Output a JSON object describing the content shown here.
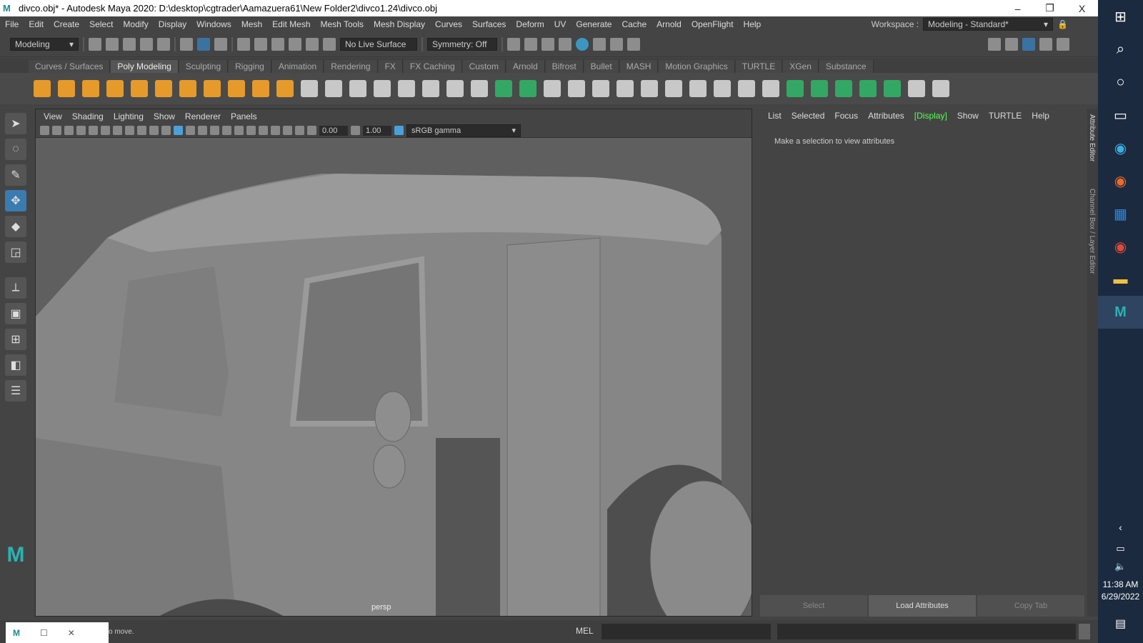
{
  "title": "divco.obj* - Autodesk Maya 2020: D:\\desktop\\cgtrader\\Aamazuera61\\New Folder2\\divco1.24\\divco.obj",
  "window_controls": {
    "minimize": "–",
    "restore": "❐",
    "close": "X"
  },
  "menus": [
    "File",
    "Edit",
    "Create",
    "Select",
    "Modify",
    "Display",
    "Windows",
    "Mesh",
    "Edit Mesh",
    "Mesh Tools",
    "Mesh Display",
    "Curves",
    "Surfaces",
    "Deform",
    "UV",
    "Generate",
    "Cache",
    "Arnold",
    "OpenFlight",
    "Help"
  ],
  "workspace": {
    "label": "Workspace :",
    "value": "Modeling - Standard*"
  },
  "statusline": {
    "mode": "Modeling",
    "live_surface": "No Live Surface",
    "symmetry": "Symmetry: Off"
  },
  "shelf_tabs": [
    "Curves / Surfaces",
    "Poly Modeling",
    "Sculpting",
    "Rigging",
    "Animation",
    "Rendering",
    "FX",
    "FX Caching",
    "Custom",
    "Arnold",
    "Bifrost",
    "Bullet",
    "MASH",
    "Motion Graphics",
    "TURTLE",
    "XGen",
    "Substance"
  ],
  "active_shelf_tab": "Poly Modeling",
  "viewport": {
    "menus": [
      "View",
      "Shading",
      "Lighting",
      "Show",
      "Renderer",
      "Panels"
    ],
    "exposure": "0.00",
    "gamma": "1.00",
    "color_space": "sRGB gamma",
    "camera": "persp"
  },
  "attribute_editor": {
    "menus": [
      "List",
      "Selected",
      "Focus",
      "Attributes",
      "[Display]",
      "Show",
      "TURTLE",
      "Help"
    ],
    "message": "Make a selection to view attributes",
    "buttons": [
      "Select",
      "Load Attributes",
      "Copy Tab"
    ]
  },
  "side_tabs": [
    "Attribute Editor",
    "Channel Box / Layer Editor"
  ],
  "helpline": {
    "text": "o move.",
    "mel_label": "MEL"
  },
  "taskbar": {
    "time": "11:38 AM",
    "date": "6/29/2022"
  }
}
